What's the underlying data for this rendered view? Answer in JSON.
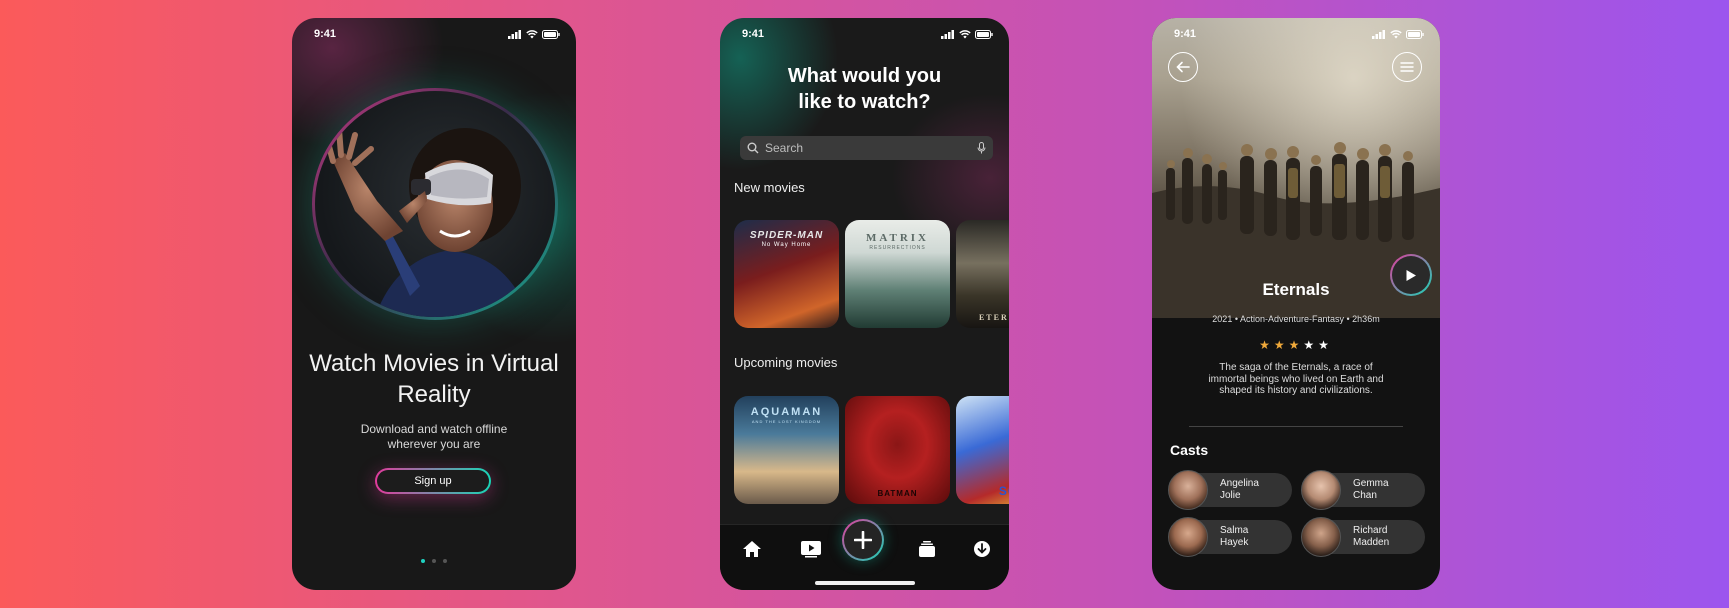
{
  "status_time": "9:41",
  "onboarding": {
    "title": "Watch Movies in Virtual Reality",
    "subtitle": "Download and watch offline wherever you are",
    "signup_label": "Sign up",
    "page_index": 1,
    "page_count": 3
  },
  "browse": {
    "title": "What would you like to watch?",
    "search_placeholder": "Search",
    "new_movies_title": "New movies",
    "new_movies": [
      {
        "poster_text": "SPIDER-MAN",
        "poster_sub": "No Way Home"
      },
      {
        "poster_text": "MATRIX",
        "poster_sub": "RESURRECTIONS"
      },
      {
        "poster_text": "ETERNALS"
      }
    ],
    "upcoming_title": "Upcoming movies",
    "upcoming_movies": [
      {
        "poster_text": "AQUAMAN",
        "poster_sub": "AND THE LOST KINGDOM"
      },
      {
        "poster_text": "BATMAN"
      },
      {
        "poster_text": "SO"
      }
    ],
    "tabbar": [
      "home-icon",
      "play-icon",
      "plus-icon",
      "library-icon",
      "download-icon"
    ]
  },
  "detail": {
    "title": "Eternals",
    "meta": "2021 • Action-Adventure-Fantasy • 2h36m",
    "rating": 3,
    "rating_max": 5,
    "description": "The saga of the Eternals, a race of immortal beings who lived on Earth and shaped its history and civilizations.",
    "casts_title": "Casts",
    "casts": [
      {
        "name": "Angelina Jolie"
      },
      {
        "name": "Gemma Chan"
      },
      {
        "name": "Salma Hayek"
      },
      {
        "name": "Richard Madden"
      }
    ]
  },
  "colors": {
    "accent_pink": "#e23a9c",
    "accent_teal": "#18d6b6",
    "star_filled": "#f0a93a",
    "star_empty": "#ffffff"
  }
}
